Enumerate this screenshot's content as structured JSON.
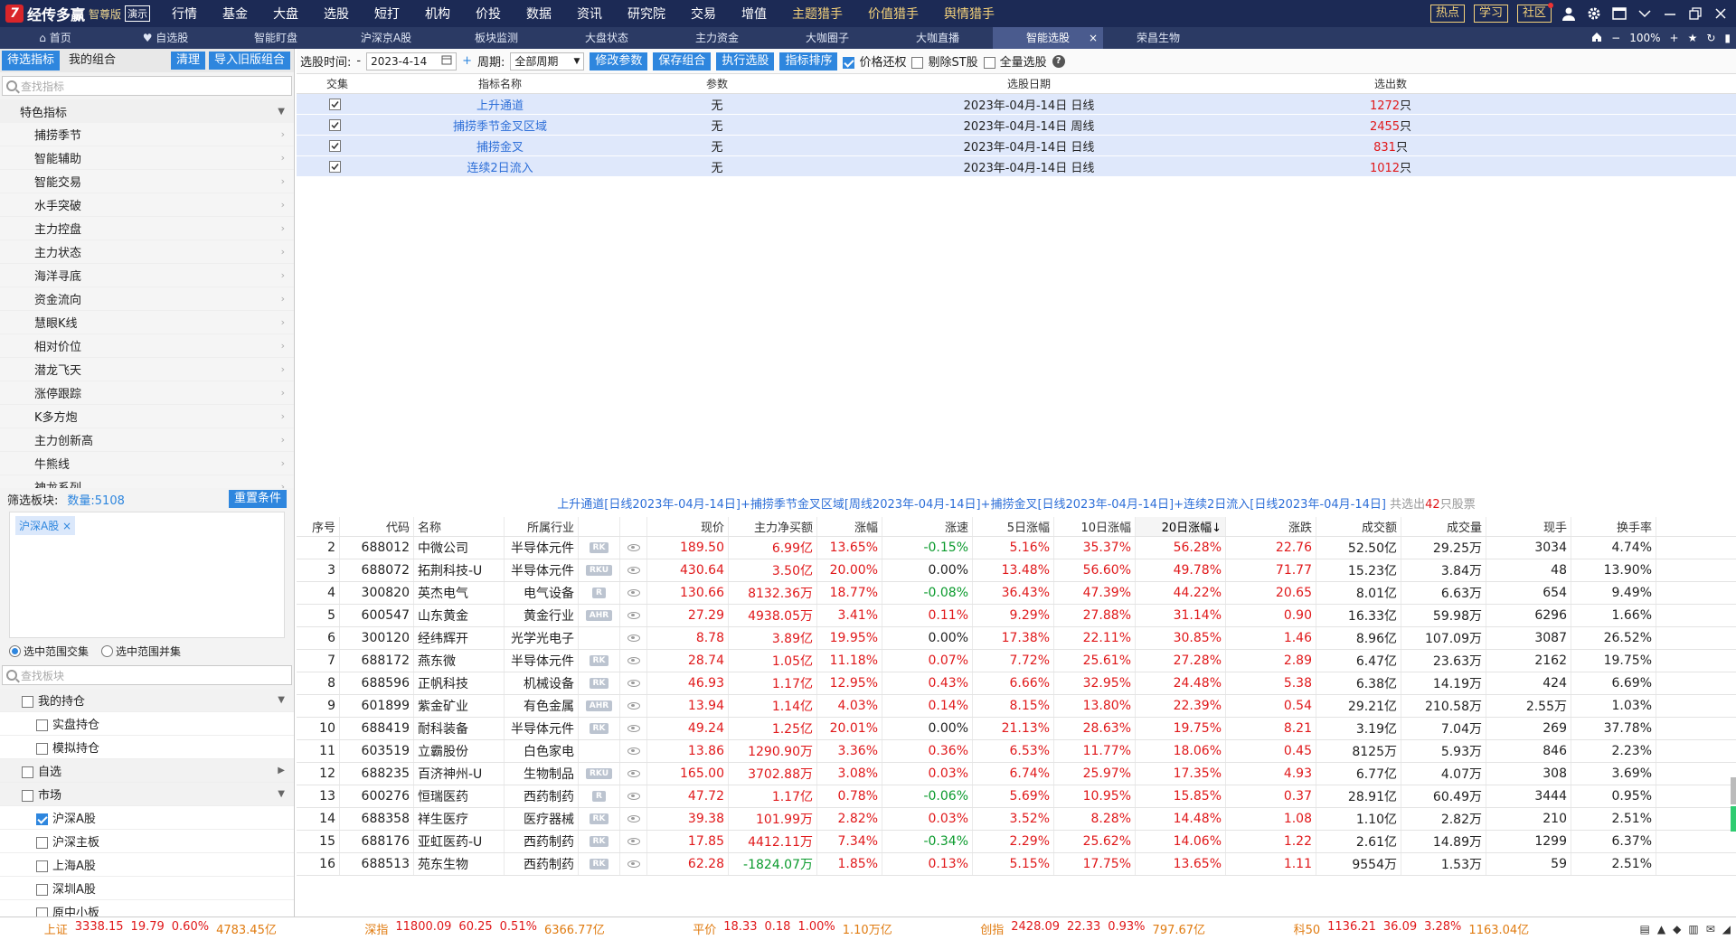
{
  "app": {
    "logo_mark": "7",
    "name": "经传多赢",
    "edition": "智尊版",
    "demo": "演示"
  },
  "menu": [
    "行情",
    "基金",
    "大盘",
    "选股",
    "短打",
    "机构",
    "价投",
    "数据",
    "资讯",
    "研究院",
    "交易",
    "增值",
    "主题猎手",
    "价值猎手",
    "舆情猎手"
  ],
  "menu_highlight": [
    "主题猎手",
    "价值猎手",
    "舆情猎手"
  ],
  "top_buttons": [
    "热点",
    "学习",
    "社区"
  ],
  "tabs": [
    {
      "label": "首页",
      "icon": "home-icon"
    },
    {
      "label": "自选股",
      "icon": "heart-icon"
    },
    {
      "label": "智能盯盘"
    },
    {
      "label": "沪深京A股"
    },
    {
      "label": "板块监测"
    },
    {
      "label": "大盘状态"
    },
    {
      "label": "主力资金"
    },
    {
      "label": "大咖圈子"
    },
    {
      "label": "大咖直播"
    },
    {
      "label": "智能选股",
      "active": true
    },
    {
      "label": "荣昌生物"
    }
  ],
  "zoom": "100%",
  "left": {
    "tab_pending": "待选指标",
    "tab_mine": "我的组合",
    "clear": "清理",
    "import": "导入旧版组合",
    "search_placeholder": "查找指标",
    "category": "特色指标",
    "items": [
      "捕捞季节",
      "智能辅助",
      "智能交易",
      "水手突破",
      "主力控盘",
      "主力状态",
      "海洋寻底",
      "资金流向",
      "慧眼K线",
      "相对价位",
      "潜龙飞天",
      "涨停跟踪",
      "K多方炮",
      "主力创新高",
      "牛熊线",
      "神龙系列"
    ],
    "filter_label": "筛选板块:",
    "filter_count": "数量:5108",
    "reset": "重置条件",
    "tag": "沪深A股",
    "radio_intersect": "选中范围交集",
    "radio_union": "选中范围并集",
    "block_search": "查找板块",
    "blocks": [
      {
        "label": "我的持仓",
        "level": 1,
        "arrow": "▼"
      },
      {
        "label": "实盘持仓",
        "level": 2
      },
      {
        "label": "模拟持仓",
        "level": 2
      },
      {
        "label": "自选",
        "level": 1,
        "arrow": "▶"
      },
      {
        "label": "市场",
        "level": 1,
        "arrow": "▼"
      },
      {
        "label": "沪深A股",
        "level": 2,
        "checked": true
      },
      {
        "label": "沪深主板",
        "level": 2
      },
      {
        "label": "上海A股",
        "level": 2
      },
      {
        "label": "深圳A股",
        "level": 2
      },
      {
        "label": "原中小板",
        "level": 2
      }
    ]
  },
  "toolbar": {
    "time_label": "选股时间:",
    "date": "2023-4-14",
    "period_label": "周期:",
    "period": "全部周期",
    "btn_modify": "修改参数",
    "btn_save": "保存组合",
    "btn_run": "执行选股",
    "btn_sort": "指标排序",
    "chk_price": "价格还权",
    "chk_st": "剔除ST股",
    "chk_all": "全量选股"
  },
  "indicators": {
    "headers": [
      "交集",
      "指标名称",
      "参数",
      "选股日期",
      "选出数"
    ],
    "rows": [
      {
        "name": "上升通道",
        "param": "无",
        "date": "2023年-04月-14日 日线",
        "count": "1272",
        "unit": "只"
      },
      {
        "name": "捕捞季节金叉区域",
        "param": "无",
        "date": "2023年-04月-14日 周线",
        "count": "2455",
        "unit": "只"
      },
      {
        "name": "捕捞金叉",
        "param": "无",
        "date": "2023年-04月-14日 日线",
        "count": "831",
        "unit": "只"
      },
      {
        "name": "连续2日流入",
        "param": "无",
        "date": "2023年-04月-14日 日线",
        "count": "1012",
        "unit": "只"
      }
    ]
  },
  "summary": {
    "text": "上升通道[日线2023年-04月-14日]+捕捞季节金叉区域[周线2023年-04月-14日]+捕捞金叉[日线2023年-04月-14日]+连续2日流入[日线2023年-04月-14日]",
    "pre": "共选出",
    "count": "42",
    "post": "只股票"
  },
  "stocks": {
    "headers": [
      "序号",
      "代码",
      "名称",
      "所属行业",
      "",
      "",
      "现价",
      "主力净买额",
      "涨幅",
      "涨速",
      "5日涨幅",
      "10日涨幅",
      "20日涨幅↓",
      "涨跌",
      "成交额",
      "成交量",
      "现手",
      "换手率"
    ],
    "rows": [
      [
        "2",
        "688012",
        "中微公司",
        "半导体元件",
        "RK",
        "189.50",
        "6.99亿",
        "13.65%",
        "-0.15%",
        "5.16%",
        "35.37%",
        "56.28%",
        "22.76",
        "52.50亿",
        "29.25万",
        "3034",
        "4.74%"
      ],
      [
        "3",
        "688072",
        "拓荆科技-U",
        "半导体元件",
        "RKU",
        "430.64",
        "3.50亿",
        "20.00%",
        "0.00%",
        "13.48%",
        "56.60%",
        "49.78%",
        "71.77",
        "15.23亿",
        "3.84万",
        "48",
        "13.90%"
      ],
      [
        "4",
        "300820",
        "英杰电气",
        "电气设备",
        "R",
        "130.66",
        "8132.36万",
        "18.77%",
        "-0.08%",
        "36.43%",
        "47.39%",
        "44.22%",
        "20.65",
        "8.01亿",
        "6.63万",
        "654",
        "9.49%"
      ],
      [
        "5",
        "600547",
        "山东黄金",
        "黄金行业",
        "AHR",
        "27.29",
        "4938.05万",
        "3.41%",
        "0.11%",
        "9.29%",
        "27.88%",
        "31.14%",
        "0.90",
        "16.33亿",
        "59.98万",
        "6296",
        "1.66%"
      ],
      [
        "6",
        "300120",
        "经纬辉开",
        "光学光电子",
        "",
        "8.78",
        "3.89亿",
        "19.95%",
        "0.00%",
        "17.38%",
        "22.11%",
        "30.85%",
        "1.46",
        "8.96亿",
        "107.09万",
        "3087",
        "26.52%"
      ],
      [
        "7",
        "688172",
        "燕东微",
        "半导体元件",
        "RK",
        "28.74",
        "1.05亿",
        "11.18%",
        "0.07%",
        "7.72%",
        "25.61%",
        "27.28%",
        "2.89",
        "6.47亿",
        "23.63万",
        "2162",
        "19.75%"
      ],
      [
        "8",
        "688596",
        "正帆科技",
        "机械设备",
        "RK",
        "46.93",
        "1.17亿",
        "12.95%",
        "0.43%",
        "6.66%",
        "32.95%",
        "24.48%",
        "5.38",
        "6.38亿",
        "14.19万",
        "424",
        "6.69%"
      ],
      [
        "9",
        "601899",
        "紫金矿业",
        "有色金属",
        "AHR",
        "13.94",
        "1.14亿",
        "4.03%",
        "0.14%",
        "8.15%",
        "13.80%",
        "22.39%",
        "0.54",
        "29.21亿",
        "210.58万",
        "2.55万",
        "1.03%"
      ],
      [
        "10",
        "688419",
        "耐科装备",
        "半导体元件",
        "RK",
        "49.24",
        "1.25亿",
        "20.01%",
        "0.00%",
        "21.13%",
        "28.63%",
        "19.75%",
        "8.21",
        "3.19亿",
        "7.04万",
        "269",
        "37.78%"
      ],
      [
        "11",
        "603519",
        "立霸股份",
        "白色家电",
        "",
        "13.86",
        "1290.90万",
        "3.36%",
        "0.36%",
        "6.53%",
        "11.77%",
        "18.06%",
        "0.45",
        "8125万",
        "5.93万",
        "846",
        "2.23%"
      ],
      [
        "12",
        "688235",
        "百济神州-U",
        "生物制品",
        "RKU",
        "165.00",
        "3702.88万",
        "3.08%",
        "0.03%",
        "6.74%",
        "25.97%",
        "17.35%",
        "4.93",
        "6.77亿",
        "4.07万",
        "308",
        "3.69%"
      ],
      [
        "13",
        "600276",
        "恒瑞医药",
        "西药制药",
        "R",
        "47.72",
        "1.17亿",
        "0.78%",
        "-0.06%",
        "5.69%",
        "10.95%",
        "15.85%",
        "0.37",
        "28.91亿",
        "60.49万",
        "3444",
        "0.95%"
      ],
      [
        "14",
        "688358",
        "祥生医疗",
        "医疗器械",
        "RK",
        "39.38",
        "101.99万",
        "2.82%",
        "0.03%",
        "3.52%",
        "8.28%",
        "14.48%",
        "1.08",
        "1.10亿",
        "2.82万",
        "210",
        "2.51%"
      ],
      [
        "15",
        "688176",
        "亚虹医药-U",
        "西药制药",
        "RK",
        "17.85",
        "4412.11万",
        "7.34%",
        "-0.34%",
        "2.29%",
        "25.62%",
        "14.06%",
        "1.22",
        "2.61亿",
        "14.89万",
        "1299",
        "6.37%"
      ],
      [
        "16",
        "688513",
        "苑东生物",
        "西药制药",
        "RK",
        "62.28",
        "-1824.07万",
        "1.85%",
        "0.13%",
        "5.15%",
        "17.75%",
        "13.65%",
        "1.11",
        "9554万",
        "1.53万",
        "59",
        "2.51%"
      ]
    ]
  },
  "statusbar": [
    {
      "name": "上证",
      "value": "3338.15",
      "change": "19.79",
      "pct": "0.60%",
      "amount": "4783.45亿"
    },
    {
      "name": "深指",
      "value": "11800.09",
      "change": "60.25",
      "pct": "0.51%",
      "amount": "6366.77亿"
    },
    {
      "name": "平价",
      "value": "18.33",
      "change": "0.18",
      "pct": "1.00%",
      "amount": "1.10万亿"
    },
    {
      "name": "创指",
      "value": "2428.09",
      "change": "22.33",
      "pct": "0.93%",
      "amount": "797.67亿"
    },
    {
      "name": "科50",
      "value": "1136.21",
      "change": "36.09",
      "pct": "3.28%",
      "amount": "1163.04亿"
    }
  ],
  "colors": {
    "up": "#e0181a",
    "down": "#0a9a2c",
    "accent": "#2e86de",
    "menubar": "#1c2a55",
    "gold": "#f5d27a"
  }
}
